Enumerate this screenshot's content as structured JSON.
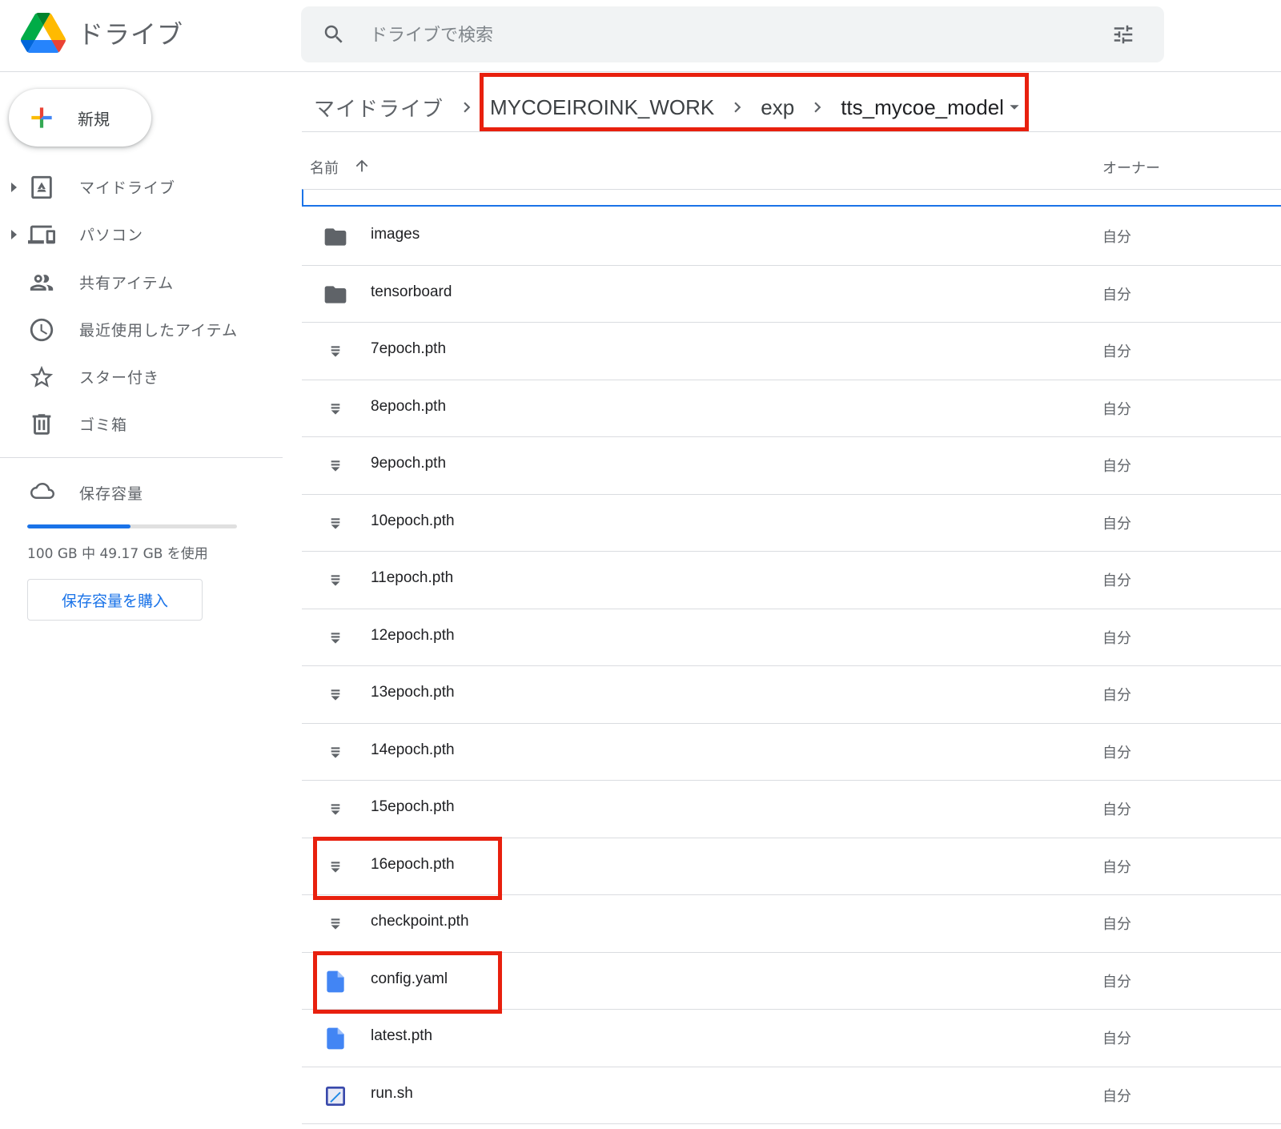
{
  "app": {
    "title": "ドライブ"
  },
  "search": {
    "placeholder": "ドライブで検索"
  },
  "sidebar": {
    "new_label": "新規",
    "items": [
      {
        "label": "マイドライブ",
        "icon": "my-drive-icon",
        "expandable": true
      },
      {
        "label": "パソコン",
        "icon": "computers-icon",
        "expandable": true
      },
      {
        "label": "共有アイテム",
        "icon": "shared-icon",
        "expandable": false
      },
      {
        "label": "最近使用したアイテム",
        "icon": "clock-icon",
        "expandable": false
      },
      {
        "label": "スター付き",
        "icon": "star-icon",
        "expandable": false
      },
      {
        "label": "ゴミ箱",
        "icon": "trash-icon",
        "expandable": false
      }
    ],
    "storage": {
      "label": "保存容量",
      "usage_text": "100 GB 中 49.17 GB を使用",
      "used_fraction": 0.4917,
      "buy_label": "保存容量を購入"
    }
  },
  "breadcrumb": {
    "items": [
      "マイドライブ",
      "MYCOEIROINK_WORK",
      "exp",
      "tts_mycoe_model"
    ]
  },
  "list": {
    "header": {
      "name": "名前",
      "owner": "オーナー"
    },
    "rows": [
      {
        "name": "images",
        "type": "folder",
        "owner": "自分"
      },
      {
        "name": "tensorboard",
        "type": "folder",
        "owner": "自分"
      },
      {
        "name": "7epoch.pth",
        "type": "binary",
        "owner": "自分"
      },
      {
        "name": "8epoch.pth",
        "type": "binary",
        "owner": "自分"
      },
      {
        "name": "9epoch.pth",
        "type": "binary",
        "owner": "自分"
      },
      {
        "name": "10epoch.pth",
        "type": "binary",
        "owner": "自分"
      },
      {
        "name": "11epoch.pth",
        "type": "binary",
        "owner": "自分"
      },
      {
        "name": "12epoch.pth",
        "type": "binary",
        "owner": "自分"
      },
      {
        "name": "13epoch.pth",
        "type": "binary",
        "owner": "自分"
      },
      {
        "name": "14epoch.pth",
        "type": "binary",
        "owner": "自分"
      },
      {
        "name": "15epoch.pth",
        "type": "binary",
        "owner": "自分"
      },
      {
        "name": "16epoch.pth",
        "type": "binary",
        "owner": "自分"
      },
      {
        "name": "checkpoint.pth",
        "type": "binary",
        "owner": "自分"
      },
      {
        "name": "config.yaml",
        "type": "doc",
        "owner": "自分"
      },
      {
        "name": "latest.pth",
        "type": "doc",
        "owner": "自分"
      },
      {
        "name": "run.sh",
        "type": "script",
        "owner": "自分"
      }
    ]
  },
  "colors": {
    "accent": "#1a73e8",
    "highlight": "#e8200e",
    "text": "#202124",
    "muted": "#5f6368"
  }
}
